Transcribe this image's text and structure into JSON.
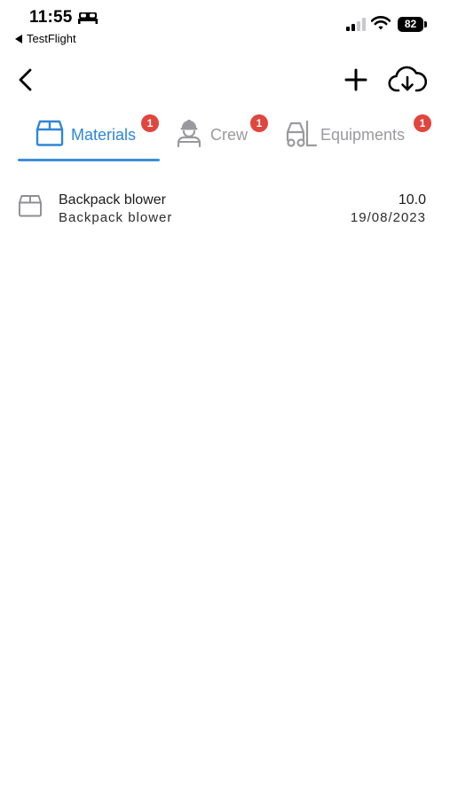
{
  "status_bar": {
    "time": "11:55",
    "back_to_app": "TestFlight",
    "battery_level": "82",
    "icons": [
      "bed-icon",
      "cellular-signal-icon",
      "wifi-icon",
      "battery-icon"
    ]
  },
  "nav": {
    "icons": [
      "chevron-left-icon",
      "plus-icon",
      "cloud-download-icon"
    ]
  },
  "tabs": [
    {
      "label": "Materials",
      "badge": "1",
      "icon": "box-icon",
      "active": true,
      "color": "#2f86d6"
    },
    {
      "label": "Crew",
      "badge": "1",
      "icon": "worker-icon",
      "active": false,
      "color": "#9a9a9e"
    },
    {
      "label": "Equipments",
      "badge": "1",
      "icon": "forklift-icon",
      "active": false,
      "color": "#9a9a9e"
    }
  ],
  "colors": {
    "accent": "#3c8fd8",
    "badge": "#e0463e",
    "inactive": "#9a9a9e"
  },
  "items": [
    {
      "icon": "box-icon",
      "title": "Backpack blower",
      "subtitle": "Backpack blower",
      "quantity": "10.0",
      "date": "19/08/2023"
    }
  ]
}
